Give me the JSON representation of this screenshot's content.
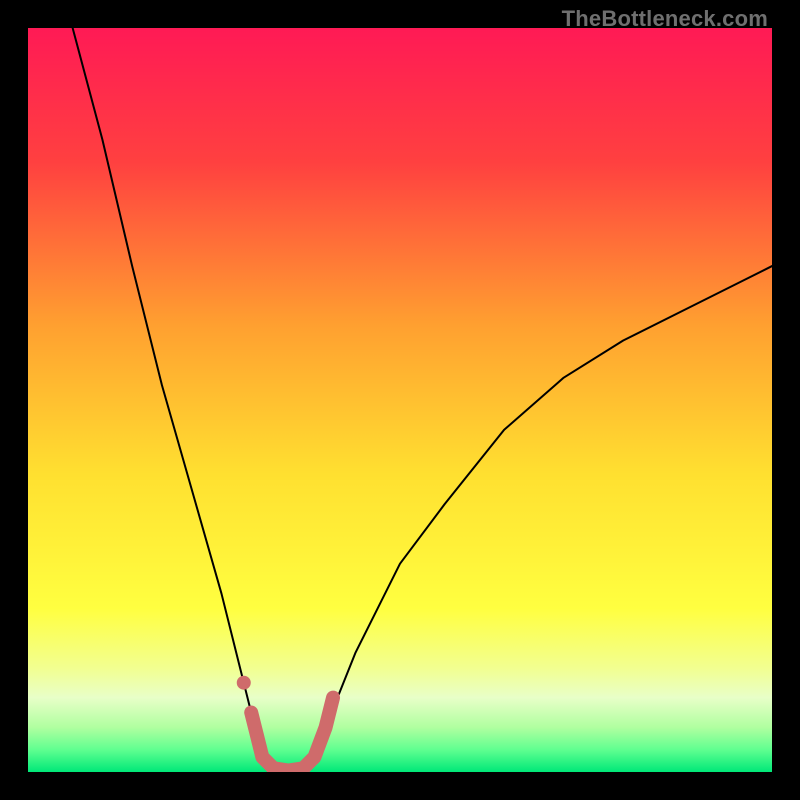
{
  "watermark": "TheBottleneck.com",
  "chart_data": {
    "type": "line",
    "title": "",
    "xlabel": "",
    "ylabel": "",
    "xlim": [
      0,
      100
    ],
    "ylim": [
      0,
      100
    ],
    "grid": false,
    "legend": false,
    "background": {
      "type": "vertical-gradient",
      "stops": [
        {
          "pos": 0.0,
          "color": "#ff1a55"
        },
        {
          "pos": 0.18,
          "color": "#ff4040"
        },
        {
          "pos": 0.4,
          "color": "#ffa030"
        },
        {
          "pos": 0.6,
          "color": "#ffe030"
        },
        {
          "pos": 0.78,
          "color": "#ffff40"
        },
        {
          "pos": 0.86,
          "color": "#f2ff90"
        },
        {
          "pos": 0.9,
          "color": "#e8ffc8"
        },
        {
          "pos": 0.94,
          "color": "#b0ffa0"
        },
        {
          "pos": 0.97,
          "color": "#60ff90"
        },
        {
          "pos": 1.0,
          "color": "#00e878"
        }
      ]
    },
    "series": [
      {
        "name": "bottleneck-curve",
        "stroke": "#000000",
        "stroke_width": 2,
        "points": [
          {
            "x": 6,
            "y": 100
          },
          {
            "x": 10,
            "y": 85
          },
          {
            "x": 14,
            "y": 68
          },
          {
            "x": 18,
            "y": 52
          },
          {
            "x": 22,
            "y": 38
          },
          {
            "x": 26,
            "y": 24
          },
          {
            "x": 28,
            "y": 16
          },
          {
            "x": 30,
            "y": 8
          },
          {
            "x": 31,
            "y": 4
          },
          {
            "x": 32,
            "y": 1
          },
          {
            "x": 34,
            "y": 0
          },
          {
            "x": 36,
            "y": 0
          },
          {
            "x": 38,
            "y": 1
          },
          {
            "x": 39,
            "y": 3
          },
          {
            "x": 40,
            "y": 6
          },
          {
            "x": 44,
            "y": 16
          },
          {
            "x": 50,
            "y": 28
          },
          {
            "x": 56,
            "y": 36
          },
          {
            "x": 64,
            "y": 46
          },
          {
            "x": 72,
            "y": 53
          },
          {
            "x": 80,
            "y": 58
          },
          {
            "x": 88,
            "y": 62
          },
          {
            "x": 96,
            "y": 66
          },
          {
            "x": 100,
            "y": 68
          }
        ]
      },
      {
        "name": "highlight-basin",
        "stroke": "#cf6b6b",
        "stroke_width": 14,
        "points": [
          {
            "x": 30.0,
            "y": 8.0
          },
          {
            "x": 30.5,
            "y": 6.0
          },
          {
            "x": 31.5,
            "y": 2.0
          },
          {
            "x": 33.0,
            "y": 0.5
          },
          {
            "x": 35.0,
            "y": 0.2
          },
          {
            "x": 37.0,
            "y": 0.5
          },
          {
            "x": 38.5,
            "y": 2.0
          },
          {
            "x": 40.0,
            "y": 6.0
          },
          {
            "x": 41.0,
            "y": 10.0
          }
        ]
      }
    ],
    "markers": [
      {
        "name": "highlight-dot",
        "x": 29.0,
        "y": 12.0,
        "r": 7,
        "fill": "#cf6b6b"
      }
    ]
  }
}
